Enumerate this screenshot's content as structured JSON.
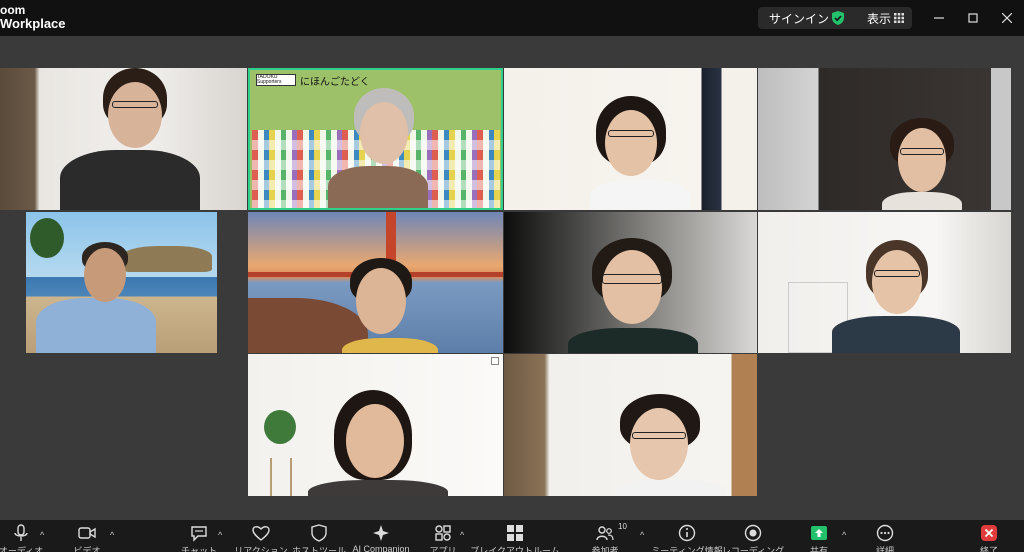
{
  "app": {
    "brand_line1": "oom",
    "brand_line2": "Workplace"
  },
  "titlebar": {
    "signin": "サインイン",
    "view": "表示"
  },
  "banner": {
    "logo_text": "TADOKU Supporters",
    "title": "にほんごたどく"
  },
  "toolbar": {
    "audio_label": "オーディオ",
    "video_label": "ビデオ",
    "chat_label": "チャット",
    "reactions_label": "リアクション",
    "host_tools_label": "ホストツール",
    "ai_label": "AI Companion",
    "apps_label": "アプリ",
    "breakout_label": "ブレイクアウトルーム",
    "participants_label": "参加者",
    "participants_count": "10",
    "meeting_info_label": "ミーティング情報",
    "record_label": "レコーディング",
    "share_label": "共有",
    "more_label": "詳細",
    "end_label": "終了"
  },
  "colors": {
    "active_border": "#2fd08a",
    "share_green": "#23c16b",
    "end_red": "#e03c3c",
    "stage_bg": "#3a3a3a"
  }
}
